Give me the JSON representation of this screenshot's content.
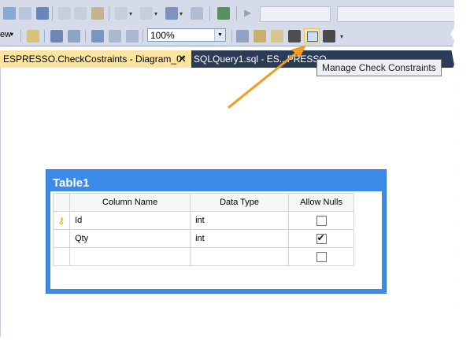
{
  "toolbar": {
    "zoom_value": "100%",
    "highlighted_button_tooltip": "Manage Check Constraints",
    "cut_off_label": "ew"
  },
  "tabs": [
    {
      "label": "ESPRESSO.CheckCostraints - Diagram_0*",
      "active": true,
      "close_glyph": "✕"
    },
    {
      "label": "SQLQuery1.sql - ES...PRESSO",
      "active": false
    }
  ],
  "diagram": {
    "table_name": "Table1",
    "columns": [
      "Column Name",
      "Data Type",
      "Allow Nulls"
    ],
    "rows": [
      {
        "key": true,
        "name": "Id",
        "type": "int",
        "allow_nulls": false
      },
      {
        "key": false,
        "name": "Qty",
        "type": "int",
        "allow_nulls": true
      },
      {
        "key": false,
        "name": "",
        "type": "",
        "allow_nulls": false
      }
    ]
  },
  "colors": {
    "accent_tab": "#fbe3a0",
    "table_header": "#3d8be8",
    "annotation_arrow": "#f39c1e",
    "tabstrip": "#2b3c59"
  }
}
